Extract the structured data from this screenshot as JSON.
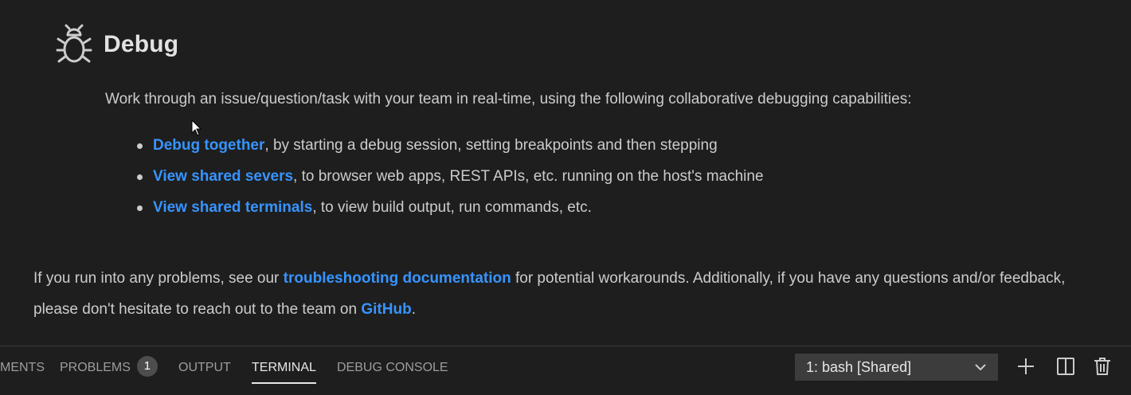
{
  "section": {
    "icon": "bug-icon",
    "title": "Debug",
    "intro": "Work through an issue/question/task with your team in real-time, using the following collaborative debugging capabilities:",
    "items": [
      {
        "link": "Debug together",
        "text": ", by starting a debug session, setting breakpoints and then stepping"
      },
      {
        "link": "View shared severs",
        "text": ", to browser web apps, REST APIs, etc. running on the host's machine"
      },
      {
        "link": "View shared terminals",
        "text": ", to view build output, run commands, etc."
      }
    ]
  },
  "footer": {
    "part1": "If you run into any problems, see our ",
    "link1": "troubleshooting documentation",
    "part2": " for potential workarounds. Additionally, if you have any questions and/or feedback, please don't hesitate to reach out to the team on ",
    "link2": "GitHub",
    "part3": "."
  },
  "panel": {
    "tabs": [
      {
        "label": "MENTS"
      },
      {
        "label": "PROBLEMS",
        "badge": "1"
      },
      {
        "label": "OUTPUT"
      },
      {
        "label": "TERMINAL",
        "active": true
      },
      {
        "label": "DEBUG CONSOLE"
      }
    ],
    "terminal_select": "1: bash [Shared]",
    "actions": [
      "plus-icon",
      "split-icon",
      "trash-icon"
    ]
  },
  "colors": {
    "background": "#1e1e1e",
    "link": "#3794ff",
    "text": "#cccccc"
  }
}
